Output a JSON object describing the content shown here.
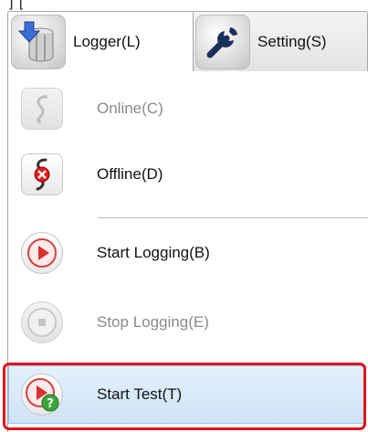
{
  "top_fragment": "] [",
  "tabs": [
    {
      "label": "Logger(L)",
      "icon": "logger-icon",
      "active": true
    },
    {
      "label": "Setting(S)",
      "icon": "wrench-icon",
      "active": false
    }
  ],
  "menu": {
    "items": [
      {
        "label": "Online(C)",
        "icon": "online-icon",
        "enabled": false
      },
      {
        "label": "Offline(D)",
        "icon": "offline-icon",
        "enabled": true
      },
      {
        "label": "Start Logging(B)",
        "icon": "play-icon",
        "enabled": true
      },
      {
        "label": "Stop Logging(E)",
        "icon": "stop-icon",
        "enabled": false
      },
      {
        "label": "Start Test(T)",
        "icon": "start-test-icon",
        "enabled": true,
        "selected": true
      }
    ]
  },
  "colors": {
    "highlight": "#e0141e",
    "selection": "#cfe4f7",
    "disabled_text": "#8a8a8a"
  }
}
